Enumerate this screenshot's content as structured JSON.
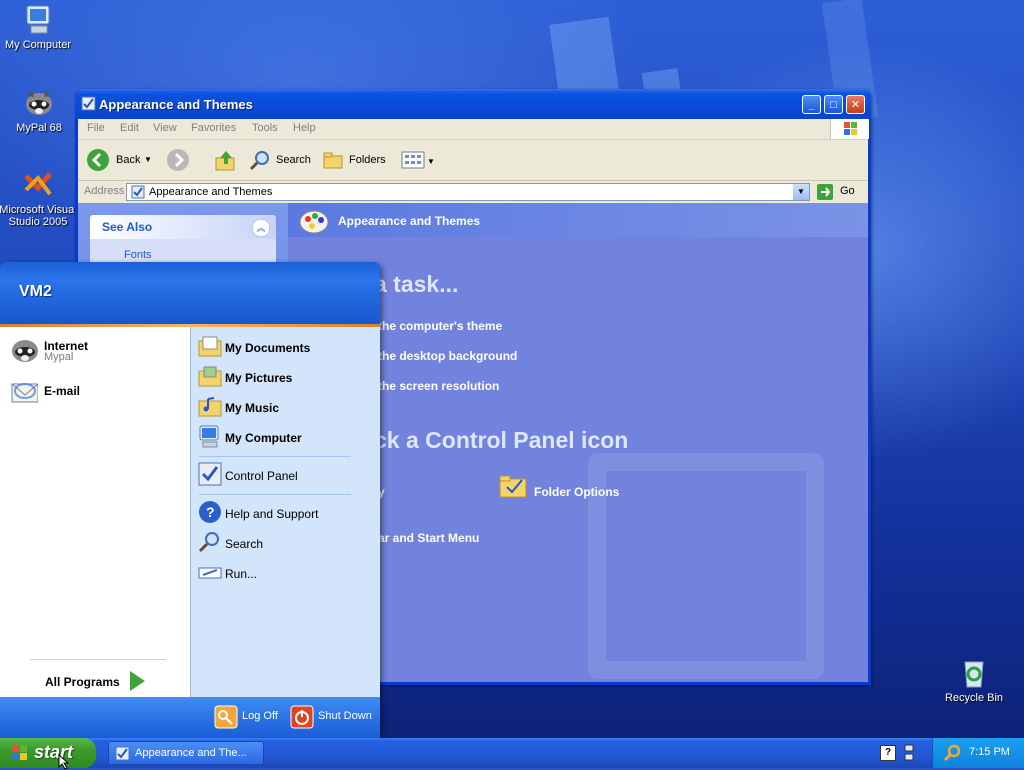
{
  "desktop": {
    "icons": [
      {
        "label": "My Computer",
        "icon": "my-computer-icon"
      },
      {
        "label": "MyPal 68",
        "icon": "mypal-raccoon-icon"
      },
      {
        "label": "Microsoft Visual Studio 2005",
        "icon": "visual-studio-icon"
      },
      {
        "label": "Recycle Bin",
        "icon": "recycle-bin-icon"
      }
    ]
  },
  "window": {
    "title": "Appearance and Themes",
    "menu": [
      "File",
      "Edit",
      "View",
      "Favorites",
      "Tools",
      "Help"
    ],
    "toolbar": {
      "back": "Back",
      "search": "Search",
      "folders": "Folders"
    },
    "address": {
      "label": "Address",
      "value": "Appearance and Themes",
      "go": "Go"
    },
    "see_also": {
      "title": "See Also",
      "first_item": "Fonts"
    },
    "header": "Appearance and Themes",
    "pick_task_title": "a task...",
    "tasks": [
      "the computer's theme",
      "the desktop background",
      "the screen resolution"
    ],
    "pick_icon_title": "ck a Control Panel icon",
    "icons": [
      "y",
      "Folder Options",
      "ar and Start Menu"
    ]
  },
  "start_menu": {
    "user": "VM2",
    "pinned": [
      {
        "label": "Internet",
        "sub": "Mypal",
        "icon": "raccoon-browser-icon"
      },
      {
        "label": "E-mail",
        "sub": "",
        "icon": "email-icon"
      }
    ],
    "all_programs": "All Programs",
    "right": {
      "my_documents": "My Documents",
      "my_pictures": "My Pictures",
      "my_music": "My Music",
      "my_computer": "My Computer",
      "control_panel": "Control Panel",
      "help": "Help and Support",
      "search": "Search",
      "run": "Run..."
    },
    "log_off": "Log Off",
    "shut_down": "Shut Down"
  },
  "taskbar": {
    "start": "start",
    "task_button": "Appearance and The...",
    "clock": "7:15 PM"
  },
  "colors": {
    "start_green": "#3c9a2c",
    "taskbar_blue": "#2458d6",
    "start_menu_right": "#d3e5fa"
  }
}
